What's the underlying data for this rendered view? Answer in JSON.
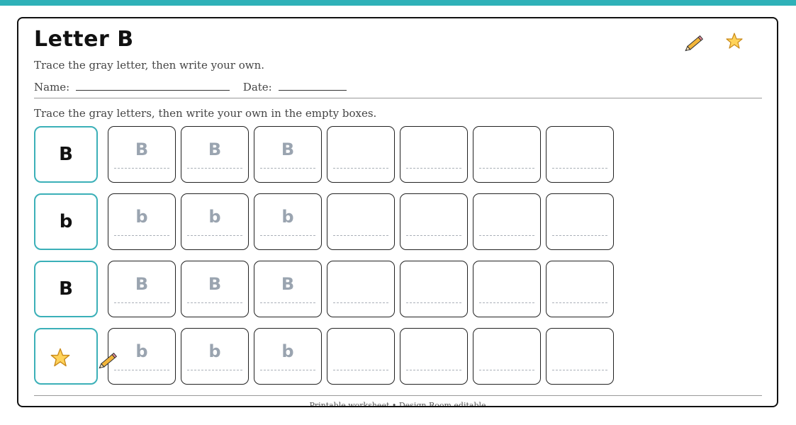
{
  "worksheet": {
    "title": "Letter B",
    "subtitle": "Trace the gray letter, then write your own.",
    "name_label": "Name:",
    "date_label": "Date:",
    "instructions": "Trace the gray letters, then write your own in the empty boxes.",
    "footer": "Printable worksheet • Design Room editable"
  },
  "decorations": [
    "pencil-icon",
    "star-icon"
  ],
  "colors": {
    "accent": "#2fb1b8",
    "model_border": "#3bb0b8",
    "trace_letter": "#9aa4b0"
  },
  "rows": [
    {
      "model": "B",
      "trace": [
        "B",
        "B",
        "B"
      ],
      "blank_count": 4
    },
    {
      "model": "b",
      "trace": [
        "b",
        "b",
        "b"
      ],
      "blank_count": 4
    },
    {
      "model": "B",
      "trace": [
        "B",
        "B",
        "B"
      ],
      "blank_count": 4
    },
    {
      "model": "",
      "trace": [
        "b",
        "b",
        "b"
      ],
      "blank_count": 4
    }
  ]
}
